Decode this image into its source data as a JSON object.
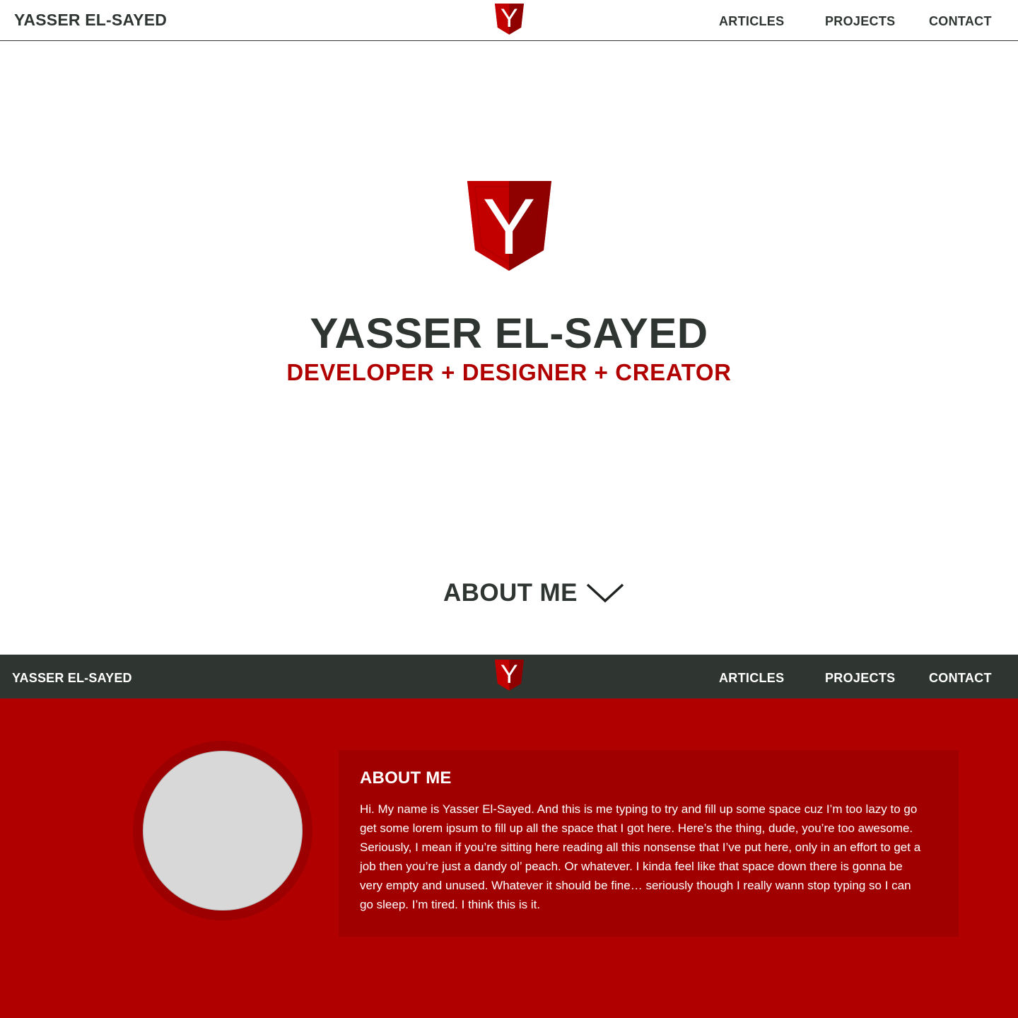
{
  "colors": {
    "accent_red": "#b10000",
    "dark_red": "#a00000",
    "charcoal": "#2f3632",
    "avatar_gray": "#d8d8d8"
  },
  "header": {
    "brand": "YASSER EL-SAYED",
    "logo_letter": "Y",
    "nav": [
      "ARTICLES",
      "PROJECTS",
      "CONTACT"
    ]
  },
  "hero": {
    "logo_letter": "Y",
    "title": "YASSER EL-SAYED",
    "subtitle": "DEVELOPER + DESIGNER + CREATOR",
    "about_toggle": "ABOUT ME",
    "toggle_icon": "chevron-down-icon"
  },
  "sticky_header": {
    "brand": "YASSER EL-SAYED",
    "logo_letter": "Y",
    "nav": [
      "ARTICLES",
      "PROJECTS",
      "CONTACT"
    ]
  },
  "about": {
    "heading": "ABOUT ME",
    "body": "Hi. My name is Yasser El-Sayed. And this is me typing to try and fill up some space cuz I’m too lazy to go get some lorem ipsum to fill up all the space that I got here. Here’s the thing, dude, you’re too awesome. Seriously, I mean if you’re sitting here reading all this nonsense that I’ve put here, only in an effort to get a job then you’re just a dandy ol’ peach. Or whatever. I kinda feel like that space down there is gonna be very empty and unused. Whatever it should be fine… seriously though I really wann stop typing so I can go sleep. I’m tired. I think this is it."
  }
}
